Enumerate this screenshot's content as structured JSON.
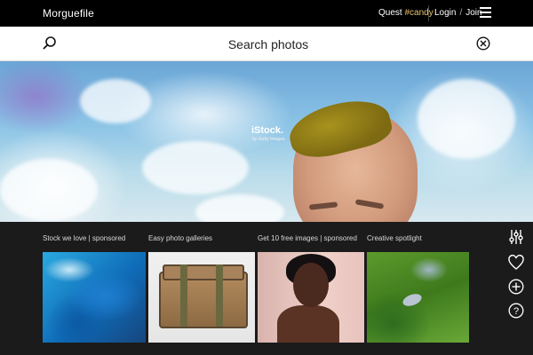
{
  "header": {
    "brand": "Morguefile",
    "quest_prefix": "Quest ",
    "quest_tag": "#candy",
    "login": "Login",
    "separator": "/",
    "join": "Join"
  },
  "search": {
    "placeholder": "Search photos",
    "value": ""
  },
  "hero": {
    "sponsor_logo": "iStock.",
    "sponsor_sub": "by Getty Images"
  },
  "sections": [
    {
      "title": "Stock we love | sponsored"
    },
    {
      "title": "Easy photo galleries"
    },
    {
      "title": "Get 10 free images | sponsored"
    },
    {
      "title": "Creative spotlight"
    }
  ],
  "icons": {
    "menu": "hamburger-icon",
    "search": "search-icon",
    "clear": "close-circle-icon",
    "filters": "sliders-icon",
    "favorites": "heart-icon",
    "add": "plus-circle-icon",
    "help": "question-circle-icon"
  },
  "colors": {
    "topbar": "#000000",
    "accent": "#e8c468",
    "panel": "#1b1b1b"
  }
}
